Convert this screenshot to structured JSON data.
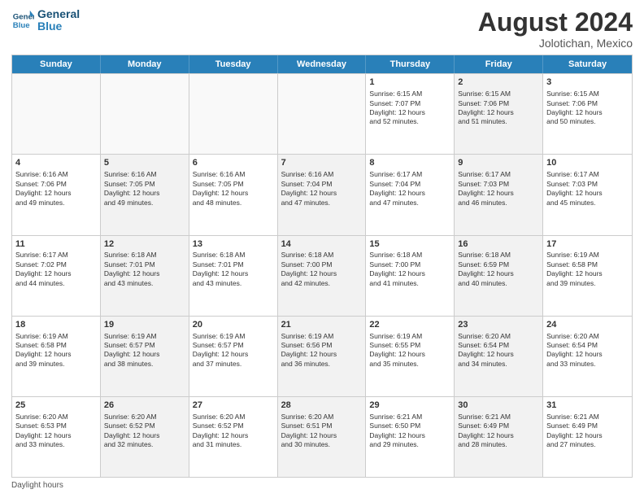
{
  "header": {
    "logo": {
      "line1": "General",
      "line2": "Blue"
    },
    "month_year": "August 2024",
    "location": "Jolotichan, Mexico"
  },
  "days_of_week": [
    "Sunday",
    "Monday",
    "Tuesday",
    "Wednesday",
    "Thursday",
    "Friday",
    "Saturday"
  ],
  "weeks": [
    [
      {
        "day": "",
        "info": "",
        "shaded": false,
        "empty": true
      },
      {
        "day": "",
        "info": "",
        "shaded": false,
        "empty": true
      },
      {
        "day": "",
        "info": "",
        "shaded": false,
        "empty": true
      },
      {
        "day": "",
        "info": "",
        "shaded": false,
        "empty": true
      },
      {
        "day": "1",
        "info": "Sunrise: 6:15 AM\nSunset: 7:07 PM\nDaylight: 12 hours\nand 52 minutes.",
        "shaded": false,
        "empty": false
      },
      {
        "day": "2",
        "info": "Sunrise: 6:15 AM\nSunset: 7:06 PM\nDaylight: 12 hours\nand 51 minutes.",
        "shaded": true,
        "empty": false
      },
      {
        "day": "3",
        "info": "Sunrise: 6:15 AM\nSunset: 7:06 PM\nDaylight: 12 hours\nand 50 minutes.",
        "shaded": false,
        "empty": false
      }
    ],
    [
      {
        "day": "4",
        "info": "Sunrise: 6:16 AM\nSunset: 7:06 PM\nDaylight: 12 hours\nand 49 minutes.",
        "shaded": false,
        "empty": false
      },
      {
        "day": "5",
        "info": "Sunrise: 6:16 AM\nSunset: 7:05 PM\nDaylight: 12 hours\nand 49 minutes.",
        "shaded": true,
        "empty": false
      },
      {
        "day": "6",
        "info": "Sunrise: 6:16 AM\nSunset: 7:05 PM\nDaylight: 12 hours\nand 48 minutes.",
        "shaded": false,
        "empty": false
      },
      {
        "day": "7",
        "info": "Sunrise: 6:16 AM\nSunset: 7:04 PM\nDaylight: 12 hours\nand 47 minutes.",
        "shaded": true,
        "empty": false
      },
      {
        "day": "8",
        "info": "Sunrise: 6:17 AM\nSunset: 7:04 PM\nDaylight: 12 hours\nand 47 minutes.",
        "shaded": false,
        "empty": false
      },
      {
        "day": "9",
        "info": "Sunrise: 6:17 AM\nSunset: 7:03 PM\nDaylight: 12 hours\nand 46 minutes.",
        "shaded": true,
        "empty": false
      },
      {
        "day": "10",
        "info": "Sunrise: 6:17 AM\nSunset: 7:03 PM\nDaylight: 12 hours\nand 45 minutes.",
        "shaded": false,
        "empty": false
      }
    ],
    [
      {
        "day": "11",
        "info": "Sunrise: 6:17 AM\nSunset: 7:02 PM\nDaylight: 12 hours\nand 44 minutes.",
        "shaded": false,
        "empty": false
      },
      {
        "day": "12",
        "info": "Sunrise: 6:18 AM\nSunset: 7:01 PM\nDaylight: 12 hours\nand 43 minutes.",
        "shaded": true,
        "empty": false
      },
      {
        "day": "13",
        "info": "Sunrise: 6:18 AM\nSunset: 7:01 PM\nDaylight: 12 hours\nand 43 minutes.",
        "shaded": false,
        "empty": false
      },
      {
        "day": "14",
        "info": "Sunrise: 6:18 AM\nSunset: 7:00 PM\nDaylight: 12 hours\nand 42 minutes.",
        "shaded": true,
        "empty": false
      },
      {
        "day": "15",
        "info": "Sunrise: 6:18 AM\nSunset: 7:00 PM\nDaylight: 12 hours\nand 41 minutes.",
        "shaded": false,
        "empty": false
      },
      {
        "day": "16",
        "info": "Sunrise: 6:18 AM\nSunset: 6:59 PM\nDaylight: 12 hours\nand 40 minutes.",
        "shaded": true,
        "empty": false
      },
      {
        "day": "17",
        "info": "Sunrise: 6:19 AM\nSunset: 6:58 PM\nDaylight: 12 hours\nand 39 minutes.",
        "shaded": false,
        "empty": false
      }
    ],
    [
      {
        "day": "18",
        "info": "Sunrise: 6:19 AM\nSunset: 6:58 PM\nDaylight: 12 hours\nand 39 minutes.",
        "shaded": false,
        "empty": false
      },
      {
        "day": "19",
        "info": "Sunrise: 6:19 AM\nSunset: 6:57 PM\nDaylight: 12 hours\nand 38 minutes.",
        "shaded": true,
        "empty": false
      },
      {
        "day": "20",
        "info": "Sunrise: 6:19 AM\nSunset: 6:57 PM\nDaylight: 12 hours\nand 37 minutes.",
        "shaded": false,
        "empty": false
      },
      {
        "day": "21",
        "info": "Sunrise: 6:19 AM\nSunset: 6:56 PM\nDaylight: 12 hours\nand 36 minutes.",
        "shaded": true,
        "empty": false
      },
      {
        "day": "22",
        "info": "Sunrise: 6:19 AM\nSunset: 6:55 PM\nDaylight: 12 hours\nand 35 minutes.",
        "shaded": false,
        "empty": false
      },
      {
        "day": "23",
        "info": "Sunrise: 6:20 AM\nSunset: 6:54 PM\nDaylight: 12 hours\nand 34 minutes.",
        "shaded": true,
        "empty": false
      },
      {
        "day": "24",
        "info": "Sunrise: 6:20 AM\nSunset: 6:54 PM\nDaylight: 12 hours\nand 33 minutes.",
        "shaded": false,
        "empty": false
      }
    ],
    [
      {
        "day": "25",
        "info": "Sunrise: 6:20 AM\nSunset: 6:53 PM\nDaylight: 12 hours\nand 33 minutes.",
        "shaded": false,
        "empty": false
      },
      {
        "day": "26",
        "info": "Sunrise: 6:20 AM\nSunset: 6:52 PM\nDaylight: 12 hours\nand 32 minutes.",
        "shaded": true,
        "empty": false
      },
      {
        "day": "27",
        "info": "Sunrise: 6:20 AM\nSunset: 6:52 PM\nDaylight: 12 hours\nand 31 minutes.",
        "shaded": false,
        "empty": false
      },
      {
        "day": "28",
        "info": "Sunrise: 6:20 AM\nSunset: 6:51 PM\nDaylight: 12 hours\nand 30 minutes.",
        "shaded": true,
        "empty": false
      },
      {
        "day": "29",
        "info": "Sunrise: 6:21 AM\nSunset: 6:50 PM\nDaylight: 12 hours\nand 29 minutes.",
        "shaded": false,
        "empty": false
      },
      {
        "day": "30",
        "info": "Sunrise: 6:21 AM\nSunset: 6:49 PM\nDaylight: 12 hours\nand 28 minutes.",
        "shaded": true,
        "empty": false
      },
      {
        "day": "31",
        "info": "Sunrise: 6:21 AM\nSunset: 6:49 PM\nDaylight: 12 hours\nand 27 minutes.",
        "shaded": false,
        "empty": false
      }
    ]
  ],
  "footer": {
    "note": "Daylight hours"
  }
}
